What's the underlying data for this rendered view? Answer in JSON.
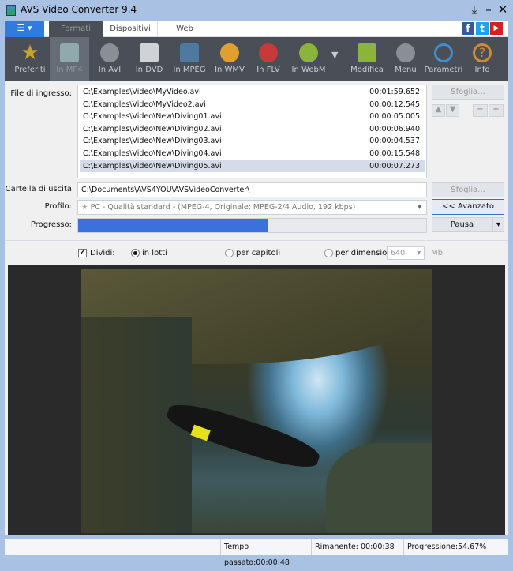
{
  "window": {
    "title": "AVS Video Converter 9.4",
    "controls": [
      "download",
      "minimize",
      "close"
    ]
  },
  "tabs": [
    {
      "label": "Formati",
      "active": true
    },
    {
      "label": "Dispositivi"
    },
    {
      "label": "Web"
    }
  ],
  "social": {
    "facebook": "f",
    "twitter": "t",
    "youtube": "▶"
  },
  "toolbar": [
    {
      "label": "Preferiti",
      "icon": "star-icon",
      "color": "#c9a227"
    },
    {
      "label": "In MP4",
      "icon": "mp4-icon",
      "color": "#8fa9ad",
      "selected": true
    },
    {
      "label": "In AVI",
      "icon": "film-reel-icon",
      "color": "#8a8f96"
    },
    {
      "label": "In DVD",
      "icon": "dvd-icon",
      "color": "#cfd3d8"
    },
    {
      "label": "In MPEG",
      "icon": "film-strip-icon",
      "color": "#4e7aa0"
    },
    {
      "label": "In WMV",
      "icon": "wmv-icon",
      "color": "#e0a030"
    },
    {
      "label": "In FLV",
      "icon": "flash-icon",
      "color": "#c8393a"
    },
    {
      "label": "In WebM",
      "icon": "webm-icon",
      "color": "#8ab43a"
    },
    {
      "label": "Modifica",
      "icon": "edit-icon",
      "color": "#8ab43a"
    },
    {
      "label": "Menù",
      "icon": "menu-disc-icon",
      "color": "#8a8f96"
    },
    {
      "label": "Parametri",
      "icon": "gear-icon",
      "color": "#3f8fd0"
    },
    {
      "label": "Info",
      "icon": "help-icon",
      "color": "#d08a30"
    }
  ],
  "input": {
    "label": "File di ingresso:",
    "browse": "Sfoglia...",
    "files": [
      {
        "path": "C:\\Examples\\Video\\MyVideo.avi",
        "duration": "00:01:59.652"
      },
      {
        "path": "C:\\Examples\\Video\\MyVideo2.avi",
        "duration": "00:00:12.545"
      },
      {
        "path": "C:\\Examples\\Video\\New\\Diving01.avi",
        "duration": "00:00:05.005"
      },
      {
        "path": "C:\\Examples\\Video\\New\\Diving02.avi",
        "duration": "00:00:06.940"
      },
      {
        "path": "C:\\Examples\\Video\\New\\Diving03.avi",
        "duration": "00:00:04.537"
      },
      {
        "path": "C:\\Examples\\Video\\New\\Diving04.avi",
        "duration": "00:00:15.548"
      },
      {
        "path": "C:\\Examples\\Video\\New\\Diving05.avi",
        "duration": "00:00:07.273",
        "selected": true
      }
    ]
  },
  "output": {
    "label": "Cartella di uscita",
    "value": "C:\\Documents\\AVS4YOU\\AVSVideoConverter\\",
    "browse": "Sfoglia..."
  },
  "profile": {
    "label": "Profilo:",
    "value": "PC - Qualità standard - (MPEG-4, Originale; MPEG-2/4 Audio, 192 kbps)",
    "advanced": "<< Avanzato"
  },
  "progress": {
    "label": "Progresso:",
    "percent": 54.67,
    "pause": "Pausa"
  },
  "split": {
    "checkbox": "Dividi:",
    "checked": true,
    "options": [
      "in lotti",
      "per capitoli",
      "per dimensione"
    ],
    "selected": "in lotti",
    "size": "640",
    "unit": "Mb"
  },
  "status": {
    "elapsed": "Tempo passato:00:00:48",
    "remaining": "Rimanente: 00:00:38",
    "progress": "Progressione:54.67%"
  }
}
